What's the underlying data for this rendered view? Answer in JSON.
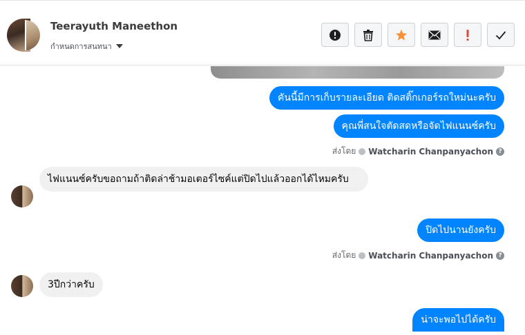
{
  "header": {
    "contact_name": "Teerayuth Maneethon",
    "subtitle": "กำหนดการสนทนา",
    "actions": [
      {
        "name": "report-button",
        "icon": "exclamation-circle-icon"
      },
      {
        "name": "delete-button",
        "icon": "trash-icon"
      },
      {
        "name": "star-button",
        "icon": "star-icon",
        "color": "#f7923b"
      },
      {
        "name": "email-button",
        "icon": "envelope-icon"
      },
      {
        "name": "important-button",
        "icon": "exclamation-icon",
        "color": "#e0473a"
      },
      {
        "name": "done-button",
        "icon": "checkmark-icon"
      }
    ]
  },
  "messages": {
    "m1": "คันนี้มีการเก็บรายละเอียด ติดสติ๊กเกอร์รถใหม่นะครับ",
    "m2": "คุณพี่สนใจตัดสดหรือจัดไฟแนนซ์ครับ",
    "m3": "ไฟแนนซ์ครับขอถามถ้าติดล่าช้ามอเตอร์ไซค์แต่ปิดไปแล้วออกได้ไหมครับ",
    "m4": "ปิดไปนานยังครับ",
    "m5": "3ปีกว่าครับ",
    "m6": "น่าจะพอไปได้ครับ"
  },
  "sent_by": {
    "label": "ส่งโดย",
    "name": "Watcharin Chanpanyachon"
  },
  "colors": {
    "outgoing_bubble": "#0084ff",
    "incoming_bubble": "#f0f0f0"
  }
}
